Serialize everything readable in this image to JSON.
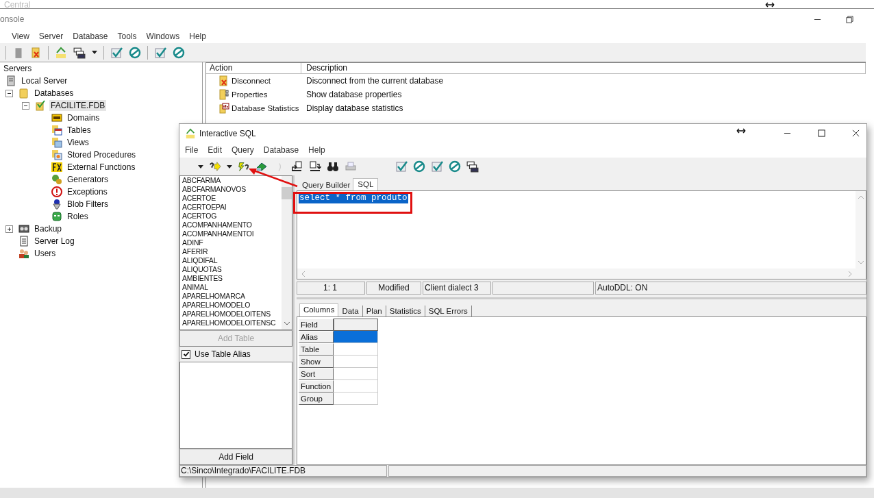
{
  "console": {
    "title_above": "Central",
    "title": "onsole",
    "menu": [
      {
        "label": "View"
      },
      {
        "label": "Server"
      },
      {
        "label": "Database"
      },
      {
        "label": "Tools"
      },
      {
        "label": "Windows"
      },
      {
        "label": "Help"
      }
    ],
    "tree": {
      "heading": "Servers",
      "items": [
        {
          "label": "Local Server",
          "kind": "server",
          "selected": false,
          "children": [
            {
              "label": "Databases",
              "kind": "folder",
              "selected": false,
              "expanded": true,
              "children": [
                {
                  "label": "FACILITE.FDB",
                  "kind": "database",
                  "selected": true,
                  "expanded": true,
                  "children": [
                    {
                      "label": "Domains",
                      "kind": "domains",
                      "selected": false
                    },
                    {
                      "label": "Tables",
                      "kind": "tables",
                      "selected": false
                    },
                    {
                      "label": "Views",
                      "kind": "views",
                      "selected": false
                    },
                    {
                      "label": "Stored Procedures",
                      "kind": "procedures",
                      "selected": false
                    },
                    {
                      "label": "External Functions",
                      "kind": "functions",
                      "selected": false
                    },
                    {
                      "label": "Generators",
                      "kind": "generators",
                      "selected": false
                    },
                    {
                      "label": "Exceptions",
                      "kind": "exceptions",
                      "selected": false
                    },
                    {
                      "label": "Blob Filters",
                      "kind": "blob",
                      "selected": false
                    },
                    {
                      "label": "Roles",
                      "kind": "roles",
                      "selected": false
                    }
                  ]
                }
              ]
            },
            {
              "label": "Backup",
              "kind": "backup",
              "selected": false,
              "expanded": false
            },
            {
              "label": "Server Log",
              "kind": "log",
              "selected": false
            },
            {
              "label": "Users",
              "kind": "users",
              "selected": false
            }
          ]
        }
      ]
    },
    "actions": {
      "columns": [
        "Action",
        "Description"
      ],
      "rows": [
        {
          "kind": "disconnect",
          "action": "Disconnect",
          "description": "Disconnect from the current database"
        },
        {
          "kind": "properties",
          "action": "Properties",
          "description": "Show database properties"
        },
        {
          "kind": "statistics",
          "action": "Database Statistics",
          "description": "Display database statistics"
        }
      ]
    }
  },
  "isql": {
    "title": "Interactive SQL",
    "menu": [
      {
        "label": "File"
      },
      {
        "label": "Edit"
      },
      {
        "label": "Query"
      },
      {
        "label": "Database"
      },
      {
        "label": "Help"
      }
    ],
    "tables": [
      "ABCFARMA",
      "ABCFARMANOVOS",
      "ACERTOE",
      "ACERTOEPAI",
      "ACERTOG",
      "ACOMPANHAMENTO",
      "ACOMPANHAMENTOI",
      "ADINF",
      "AFERIR",
      "ALIQDIFAL",
      "ALIQUOTAS",
      "AMBIENTES",
      "ANIMAL",
      "APARELHOMARCA",
      "APARELHOMODELO",
      "APARELHOMODELOITENS",
      "APARELHOMODELOITENSC"
    ],
    "add_table": {
      "label": "Add Table",
      "disabled": true
    },
    "use_alias": {
      "label": "Use Table Alias",
      "checked": true
    },
    "add_field": {
      "label": "Add Field",
      "disabled": false
    },
    "editor_tabs": [
      {
        "label": "Query Builder",
        "selected": false
      },
      {
        "label": "SQL",
        "selected": true
      }
    ],
    "sql": {
      "text": "select * from produto",
      "selected": true
    },
    "status": [
      "1: 1",
      "Modified",
      "Client dialect 3",
      "AutoDDL: ON"
    ],
    "result_tabs": [
      {
        "label": "Columns",
        "selected": true
      },
      {
        "label": "Data",
        "selected": false
      },
      {
        "label": "Plan",
        "selected": false
      },
      {
        "label": "Statistics",
        "selected": false
      },
      {
        "label": "SQL Errors",
        "selected": false
      }
    ],
    "grid": [
      {
        "label": "Field",
        "selected": false
      },
      {
        "label": "Alias",
        "selected": true
      },
      {
        "label": "Table",
        "selected": false
      },
      {
        "label": "Show",
        "selected": false
      },
      {
        "label": "Sort",
        "selected": false
      },
      {
        "label": "Function",
        "selected": false
      },
      {
        "label": "Group",
        "selected": false
      }
    ],
    "path": "C:\\Sinco\\Integrado\\FACILITE.FDB"
  }
}
